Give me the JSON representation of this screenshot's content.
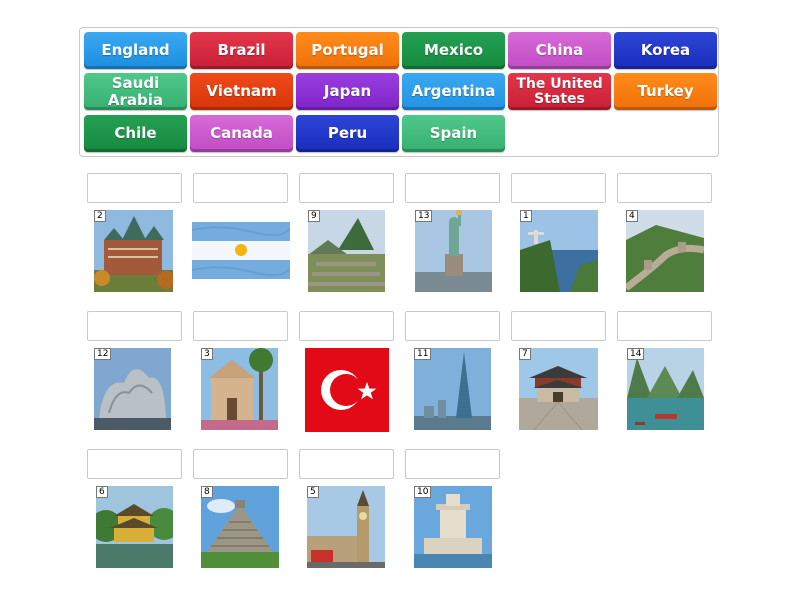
{
  "word_bank": {
    "tiles": [
      {
        "label": "England",
        "color": "#1c8ee0"
      },
      {
        "label": "Brazil",
        "color": "#c91f36"
      },
      {
        "label": "Portugal",
        "color": "#f0700a"
      },
      {
        "label": "Mexico",
        "color": "#168a40"
      },
      {
        "label": "China",
        "color": "#c04cc4"
      },
      {
        "label": "Korea",
        "color": "#1a2dbd"
      },
      {
        "label": "Saudi Arabia",
        "color": "#36b070"
      },
      {
        "label": "Vietnam",
        "color": "#d83508"
      },
      {
        "label": "Japan",
        "color": "#7f24c8"
      },
      {
        "label": "Argentina",
        "color": "#2292e2"
      },
      {
        "label": "The United States",
        "color": "#c91f36"
      },
      {
        "label": "Turkey",
        "color": "#f0700a"
      },
      {
        "label": "Chile",
        "color": "#168a40"
      },
      {
        "label": "Canada",
        "color": "#c04cc4"
      },
      {
        "label": "Peru",
        "color": "#1a2dbd"
      },
      {
        "label": "Spain",
        "color": "#36b070"
      }
    ]
  },
  "cards": [
    {
      "number": "2",
      "icon": "chateau-frontenac-icon"
    },
    {
      "number": "",
      "icon": "argentina-flag-icon"
    },
    {
      "number": "9",
      "icon": "machu-picchu-icon"
    },
    {
      "number": "13",
      "icon": "statue-of-liberty-icon"
    },
    {
      "number": "1",
      "icon": "christ-the-redeemer-icon"
    },
    {
      "number": "4",
      "icon": "great-wall-icon"
    },
    {
      "number": "12",
      "icon": "guggenheim-bilbao-icon"
    },
    {
      "number": "3",
      "icon": "mexico-church-icon"
    },
    {
      "number": "",
      "icon": "turkey-flag-icon"
    },
    {
      "number": "11",
      "icon": "riyadh-tower-icon"
    },
    {
      "number": "7",
      "icon": "namdaemun-gate-icon"
    },
    {
      "number": "14",
      "icon": "ha-long-bay-icon"
    },
    {
      "number": "6",
      "icon": "kinkakuji-icon"
    },
    {
      "number": "8",
      "icon": "chichen-itza-icon"
    },
    {
      "number": "5",
      "icon": "big-ben-icon"
    },
    {
      "number": "10",
      "icon": "belem-tower-icon"
    }
  ]
}
